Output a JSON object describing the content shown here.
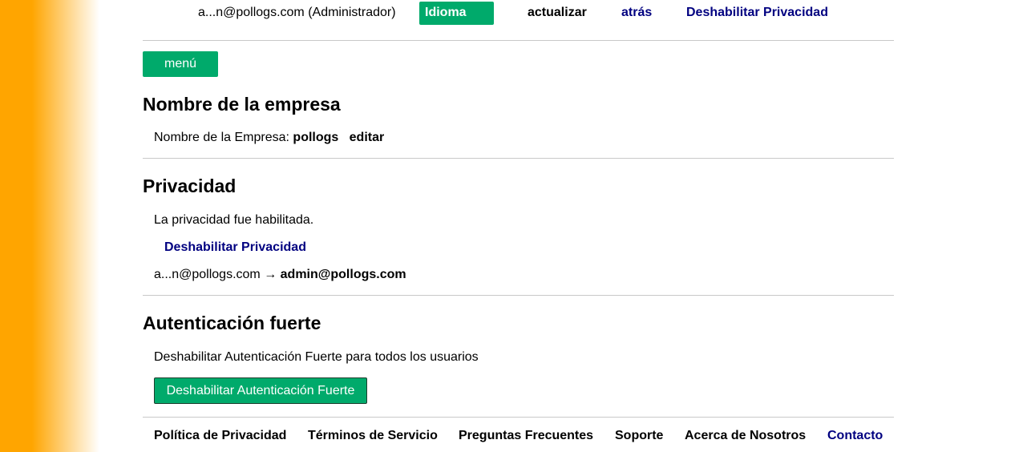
{
  "topbar": {
    "user": "a...n@pollogs.com (Administrador)",
    "language_button": "Idioma",
    "refresh": "actualizar",
    "back": "atrás",
    "privacy_disable": "Deshabilitar Privacidad"
  },
  "menu_button": "menú",
  "company_section": {
    "title": "Nombre de la empresa",
    "label": "Nombre de la Empresa:",
    "value": "pollogs",
    "edit": "editar"
  },
  "privacy_section": {
    "title": "Privacidad",
    "status": "La privacidad fue habilitada.",
    "disable_link": "Deshabilitar Privacidad",
    "masked_email": "a...n@pollogs.com",
    "arrow": "→",
    "real_email": "admin@pollogs.com"
  },
  "auth_section": {
    "title": "Autenticación fuerte",
    "description": "Deshabilitar Autenticación Fuerte para todos los usuarios",
    "disable_button": "Deshabilitar Autenticación Fuerte"
  },
  "footer": {
    "privacy_policy": "Política de Privacidad",
    "terms": "Términos de Servicio",
    "faq": "Preguntas Frecuentes",
    "support": "Soporte",
    "about": "Acerca de Nosotros",
    "contact": "Contacto"
  },
  "colors": {
    "accent_green": "#00aa6b",
    "link_navy": "#000080",
    "sidebar_orange": "#ffa500"
  }
}
